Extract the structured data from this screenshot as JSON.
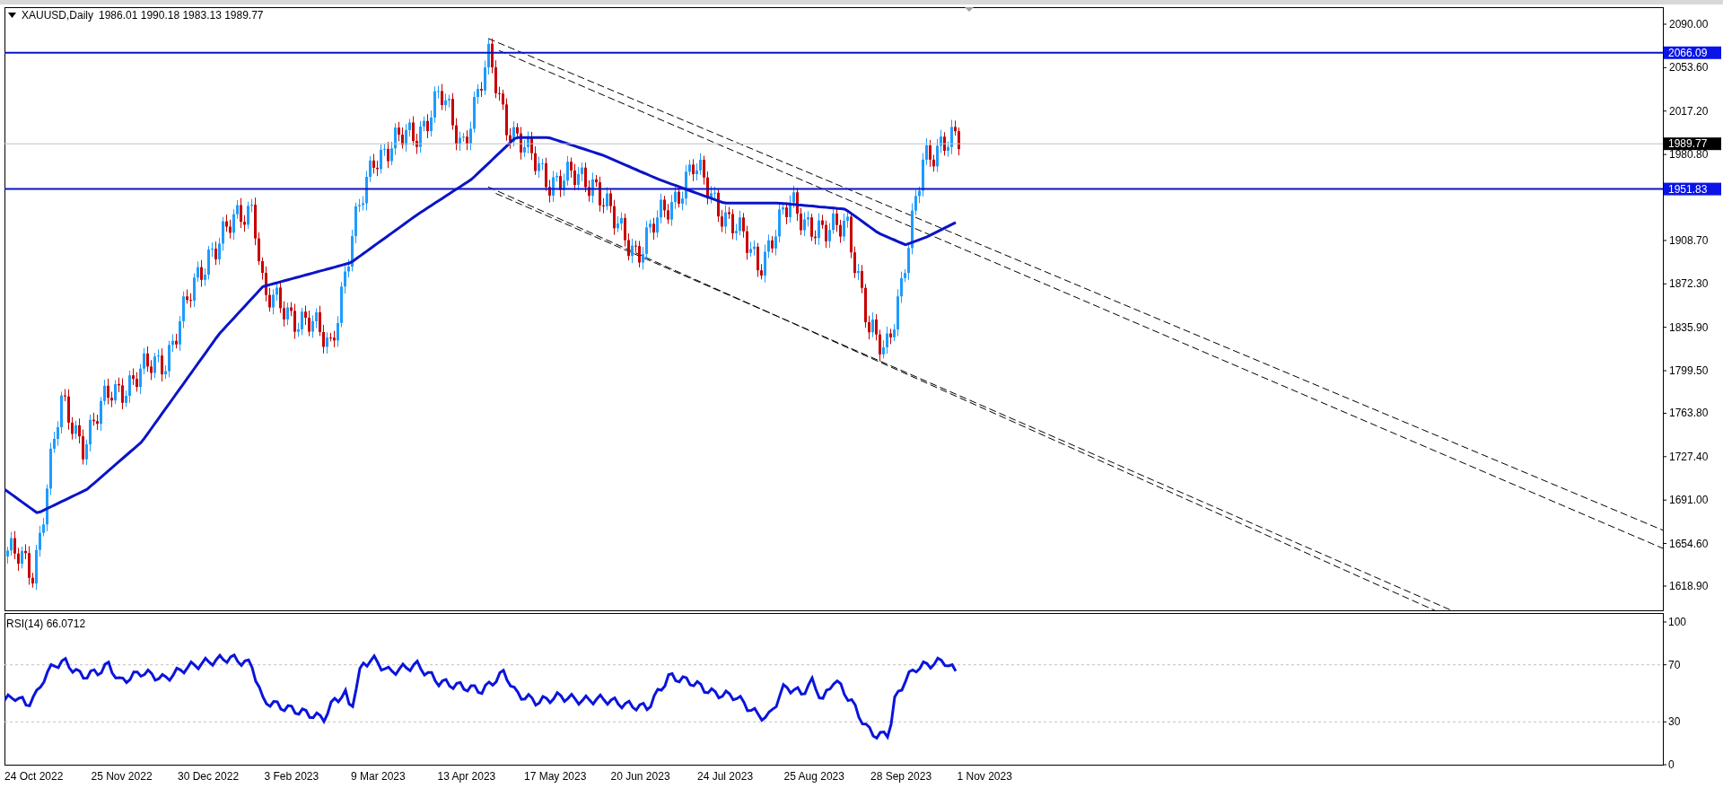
{
  "header": {
    "symbol": "XAUUSD,Daily",
    "ohlc": "1986.01 1990.18 1983.13 1989.77"
  },
  "price_axis": {
    "ticks": [
      "2090.00",
      "2053.60",
      "2017.20",
      "1980.80",
      "1908.70",
      "1872.30",
      "1835.90",
      "1799.50",
      "1763.80",
      "1727.40",
      "1691.00",
      "1654.60",
      "1618.90"
    ],
    "tags": [
      {
        "value": "2066.09",
        "kind": "level"
      },
      {
        "value": "1989.77",
        "kind": "bid"
      },
      {
        "value": "1951.83",
        "kind": "level"
      }
    ]
  },
  "rsi": {
    "title": "RSI(14) 66.0712",
    "ticks": [
      "100",
      "70",
      "30",
      "0"
    ]
  },
  "time_axis": {
    "labels": [
      "24 Oct 2022",
      "25 Nov 2022",
      "30 Dec 2022",
      "3 Feb 2023",
      "9 Mar 2023",
      "13 Apr 2023",
      "17 May 2023",
      "20 Jun 2023",
      "24 Jul 2023",
      "25 Aug 2023",
      "28 Sep 2023",
      "1 Nov 2023"
    ]
  }
}
